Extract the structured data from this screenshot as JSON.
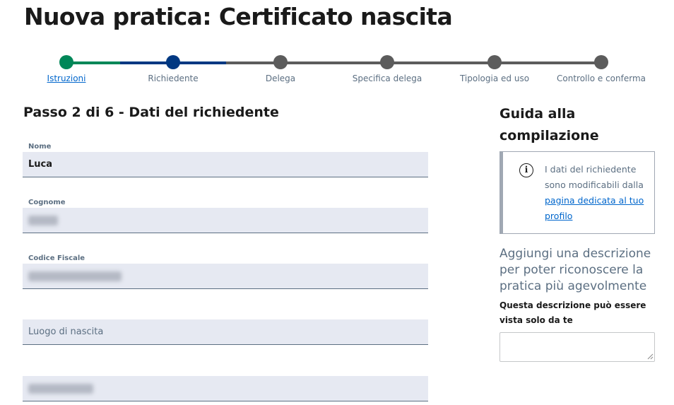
{
  "page": {
    "title": "Nuova pratica: Certificato nascita"
  },
  "stepper": {
    "steps": [
      {
        "label": "Istruzioni",
        "state": "completed",
        "color": "#008758"
      },
      {
        "label": "Richiedente",
        "state": "current",
        "color": "#003882"
      },
      {
        "label": "Delega",
        "state": "pending",
        "color": "#5c5c5c"
      },
      {
        "label": "Specifica delega",
        "state": "pending",
        "color": "#5c5c5c"
      },
      {
        "label": "Tipologia ed uso",
        "state": "pending",
        "color": "#5c5c5c"
      },
      {
        "label": "Controllo e conferma",
        "state": "pending",
        "color": "#5c5c5c"
      }
    ]
  },
  "form": {
    "section_title": "Passo 2 di 6 - Dati del richiedente",
    "fields": [
      {
        "label": "Nome",
        "value": "Luca",
        "redacted": false
      },
      {
        "label": "Cognome",
        "value": "",
        "redacted": true
      },
      {
        "label": "Codice Fiscale",
        "value": "",
        "redacted": true
      },
      {
        "label": "",
        "placeholder": "Luogo di nascita",
        "redacted": false
      },
      {
        "label": "",
        "value": "",
        "redacted": true
      }
    ]
  },
  "aside": {
    "title": "Guida alla compilazione",
    "callout": {
      "icon": "info-icon",
      "text": "I dati del richiedente sono modificabili dalla",
      "link_text": "pagina dedicata al tuo profilo"
    },
    "description": {
      "title": "Aggiungi una descrizione per poter riconoscere la pratica più agevolmente",
      "hint": "Questa descrizione può essere vista solo da te",
      "value": ""
    }
  },
  "colors": {
    "accent": "#0066cc",
    "field_bg": "#e6e9f2",
    "muted_text": "#5c6f82"
  }
}
